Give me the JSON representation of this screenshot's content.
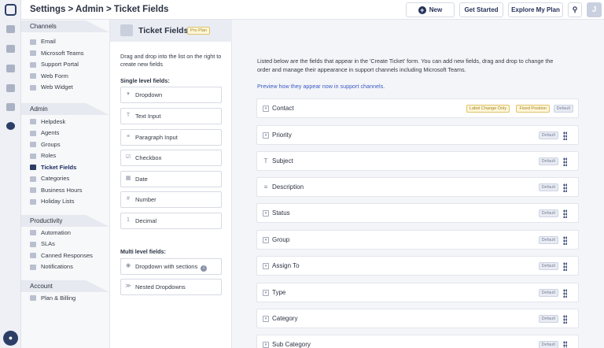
{
  "header": {
    "breadcrumb": "Settings > Admin > Ticket Fields",
    "new_label": "New",
    "get_started": "Get Started",
    "explore_plan": "Explore My Plan",
    "avatar_initial": "J"
  },
  "nav": {
    "channels": {
      "title": "Channels",
      "items": [
        "Email",
        "Microsoft Teams",
        "Support Portal",
        "Web Form",
        "Web Widget"
      ]
    },
    "admin": {
      "title": "Admin",
      "items": [
        "Helpdesk",
        "Agents",
        "Groups",
        "Roles",
        "Ticket Fields",
        "Categories",
        "Business Hours",
        "Holiday Lists"
      ]
    },
    "productivity": {
      "title": "Productivity",
      "items": [
        "Automation",
        "SLAs",
        "Canned Responses",
        "Notifications"
      ]
    },
    "account": {
      "title": "Account",
      "items": [
        "Plan & Billing"
      ]
    }
  },
  "panel": {
    "title": "Ticket Fields",
    "badge": "Pro Plan",
    "description": "Drag and drop into the list on the right to create new fields",
    "single_heading": "Single level fields:",
    "single_fields": [
      "Dropdown",
      "Text Input",
      "Paragraph Input",
      "Checkbox",
      "Date",
      "Number",
      "Decimal"
    ],
    "multi_heading": "Multi level fields:",
    "multi_fields": [
      "Dropdown with sections",
      "Nested Dropdowns"
    ]
  },
  "main": {
    "description": "Listed below are the fields that appear in the 'Create Ticket' form. You can add new fields, drag and drop to change the order and manage their appearance in support channels including Microsoft Teams.",
    "preview_link": "Preview how they appear now in support channels.",
    "contact_badges": [
      "Label Change Only",
      "Fixed Position",
      "Default"
    ],
    "default_badge": "Default",
    "fields": [
      "Contact",
      "Priority",
      "Subject",
      "Description",
      "Status",
      "Group",
      "Assign To",
      "Type",
      "Category",
      "Sub Category"
    ]
  }
}
